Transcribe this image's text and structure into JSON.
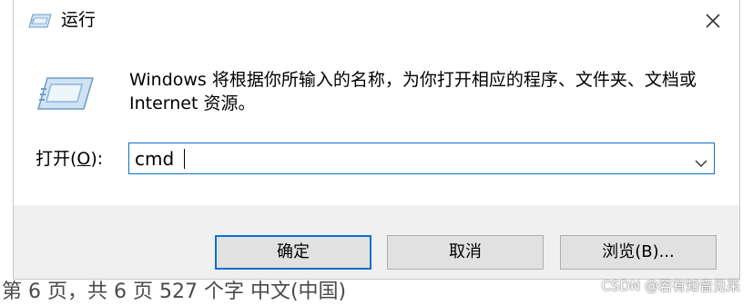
{
  "window": {
    "title": "运行",
    "close_glyph": "close-icon"
  },
  "description": "Windows 将根据你所输入的名称，为你打开相应的程序、文件夹、文档或 Internet 资源。",
  "open_field": {
    "label_prefix": "打开(",
    "label_accel": "O",
    "label_suffix": "):",
    "value": "cmd"
  },
  "buttons": {
    "ok": "确定",
    "cancel": "取消",
    "browse": "浏览(B)..."
  },
  "background_text": "第 6 页，共 6 页    527 个字    中文(中国)",
  "watermark": "CSDN @若有知音见采",
  "colors": {
    "accent": "#0a6fd1",
    "footer_bg": "#f0f0f0",
    "button_bg": "#e1e1e1"
  },
  "icons": [
    "run-icon",
    "run-large-icon",
    "close-icon",
    "chevron-down-icon"
  ]
}
